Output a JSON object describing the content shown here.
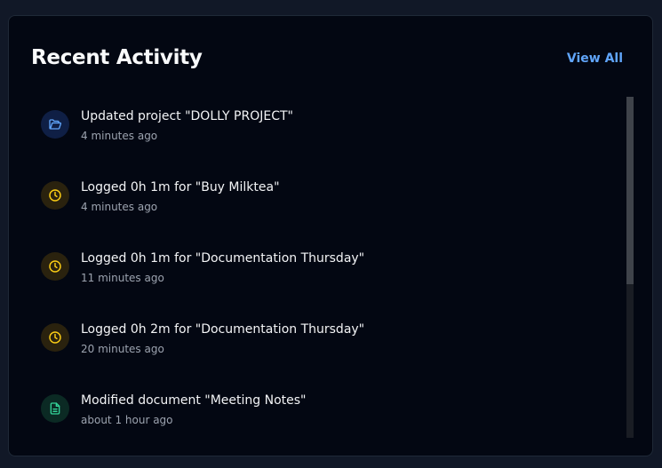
{
  "header": {
    "title": "Recent Activity",
    "view_all_label": "View All"
  },
  "activities": [
    {
      "icon": "folder-open-icon",
      "color": "#60a5fa",
      "text": "Updated project \"DOLLY PROJECT\"",
      "time": "4 minutes ago"
    },
    {
      "icon": "clock-icon",
      "color": "#facc15",
      "text": "Logged 0h 1m for \"Buy Milktea\"",
      "time": "4 minutes ago"
    },
    {
      "icon": "clock-icon",
      "color": "#facc15",
      "text": "Logged 0h 1m for \"Documentation Thursday\"",
      "time": "11 minutes ago"
    },
    {
      "icon": "clock-icon",
      "color": "#facc15",
      "text": "Logged 0h 2m for \"Documentation Thursday\"",
      "time": "20 minutes ago"
    },
    {
      "icon": "document-icon",
      "color": "#34d399",
      "text": "Modified document \"Meeting Notes\"",
      "time": "about 1 hour ago"
    }
  ],
  "colors": {
    "background": "#111827",
    "card": "#030712",
    "accent": "#60a5fa",
    "yellow": "#facc15",
    "green": "#34d399"
  },
  "scrollbar": {
    "scroll_position": 0,
    "visible_fraction": 0.55
  }
}
